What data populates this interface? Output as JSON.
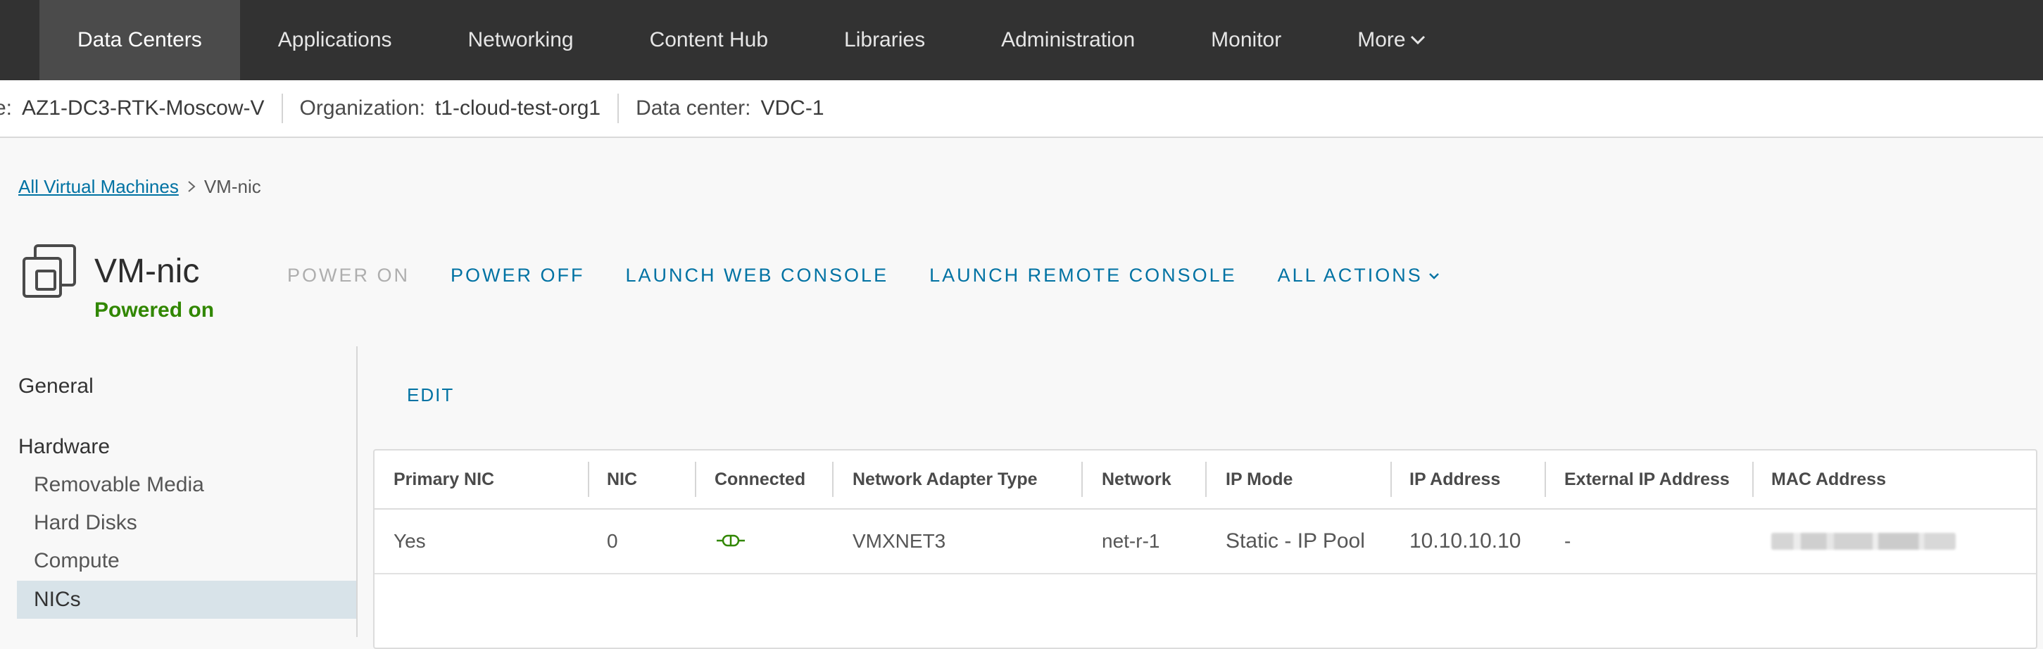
{
  "topnav": {
    "items": [
      {
        "label": "Data Centers",
        "active": true
      },
      {
        "label": "Applications",
        "active": false
      },
      {
        "label": "Networking",
        "active": false
      },
      {
        "label": "Content Hub",
        "active": false
      },
      {
        "label": "Libraries",
        "active": false
      },
      {
        "label": "Administration",
        "active": false
      },
      {
        "label": "Monitor",
        "active": false
      },
      {
        "label": "More",
        "active": false
      }
    ]
  },
  "context": {
    "site_key": "e:",
    "site_val": "AZ1-DC3-RTK-Moscow-V",
    "org_key": "Organization:",
    "org_val": "t1-cloud-test-org1",
    "dc_key": "Data center:",
    "dc_val": "VDC-1"
  },
  "breadcrumb": {
    "parent": "All Virtual Machines",
    "current": "VM-nic"
  },
  "vm": {
    "name": "VM-nic",
    "status": "Powered on",
    "status_color": "#318700"
  },
  "actions": {
    "power_on": "POWER ON",
    "power_off": "POWER OFF",
    "web_console": "LAUNCH WEB CONSOLE",
    "remote_console": "LAUNCH REMOTE CONSOLE",
    "all_actions": "ALL ACTIONS"
  },
  "sidebar": {
    "general": "General",
    "hardware": "Hardware",
    "items": [
      "Removable Media",
      "Hard Disks",
      "Compute",
      "NICs"
    ],
    "selected": "NICs"
  },
  "main": {
    "edit_label": "EDIT"
  },
  "nic_table": {
    "headers": [
      "Primary NIC",
      "NIC",
      "Connected",
      "Network Adapter Type",
      "Network",
      "IP Mode",
      "IP Address",
      "External IP Address",
      "MAC Address"
    ],
    "rows": [
      {
        "primary": "Yes",
        "nic": "0",
        "connected_icon": "connected-plug-icon",
        "adapter": "VMXNET3",
        "network": "net-r-1",
        "ip_mode": "Static - IP Pool",
        "ip_address": "10.10.10.10",
        "external_ip": "-",
        "mac": "redacted"
      }
    ]
  },
  "colors": {
    "nav_bg": "#323232",
    "link": "#0072a3",
    "selected_bg": "#d8e3e9",
    "connected_green": "#318700"
  }
}
